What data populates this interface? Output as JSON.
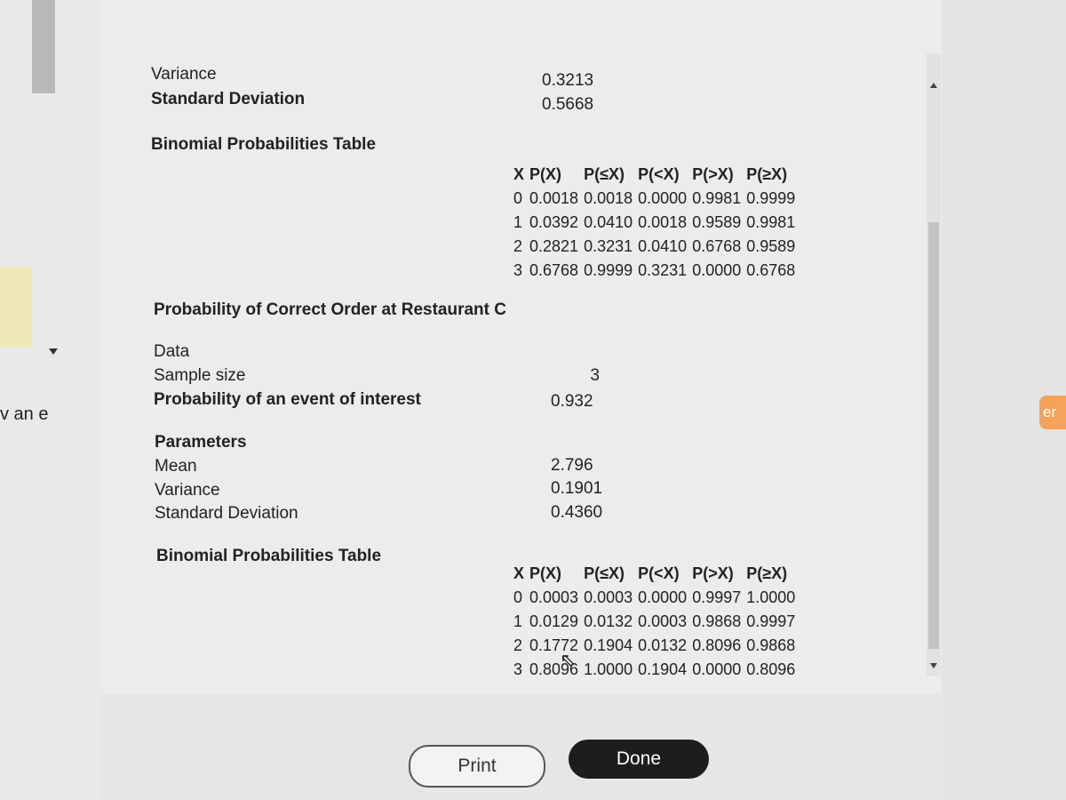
{
  "background": {
    "left_text": "v an e",
    "right_button": "er"
  },
  "section_a": {
    "variance_label": "Variance",
    "variance": "0.3213",
    "sd_label": "Standard Deviation",
    "sd": "0.5668",
    "table_title": "Binomial Probabilities Table",
    "headers": [
      "X",
      "P(X)",
      "P(≤X)",
      "P(<X)",
      "P(>X)",
      "P(≥X)"
    ],
    "rows": [
      [
        "0",
        "0.0018",
        "0.0018",
        "0.0000",
        "0.9981",
        "0.9999"
      ],
      [
        "1",
        "0.0392",
        "0.0410",
        "0.0018",
        "0.9589",
        "0.9981"
      ],
      [
        "2",
        "0.2821",
        "0.3231",
        "0.0410",
        "0.6768",
        "0.9589"
      ],
      [
        "3",
        "0.6768",
        "0.9999",
        "0.3231",
        "0.0000",
        "0.6768"
      ]
    ]
  },
  "section_c": {
    "title": "Probability of Correct Order at Restaurant C",
    "data_label": "Data",
    "sample_size_label": "Sample size",
    "sample_size": "3",
    "prob_label": "Probability of an event of interest",
    "prob": "0.932",
    "params_label": "Parameters",
    "mean_label": "Mean",
    "mean": "2.796",
    "variance_label": "Variance",
    "variance": "0.1901",
    "sd_label": "Standard Deviation",
    "sd": "0.4360",
    "table_title": "Binomial Probabilities Table",
    "headers": [
      "X",
      "P(X)",
      "P(≤X)",
      "P(<X)",
      "P(>X)",
      "P(≥X)"
    ],
    "rows": [
      [
        "0",
        "0.0003",
        "0.0003",
        "0.0000",
        "0.9997",
        "1.0000"
      ],
      [
        "1",
        "0.0129",
        "0.0132",
        "0.0003",
        "0.9868",
        "0.9997"
      ],
      [
        "2",
        "0.1772",
        "0.1904",
        "0.0132",
        "0.8096",
        "0.9868"
      ],
      [
        "3",
        "0.8096",
        "1.0000",
        "0.1904",
        "0.0000",
        "0.8096"
      ]
    ]
  },
  "buttons": {
    "print": "Print",
    "done": "Done"
  }
}
